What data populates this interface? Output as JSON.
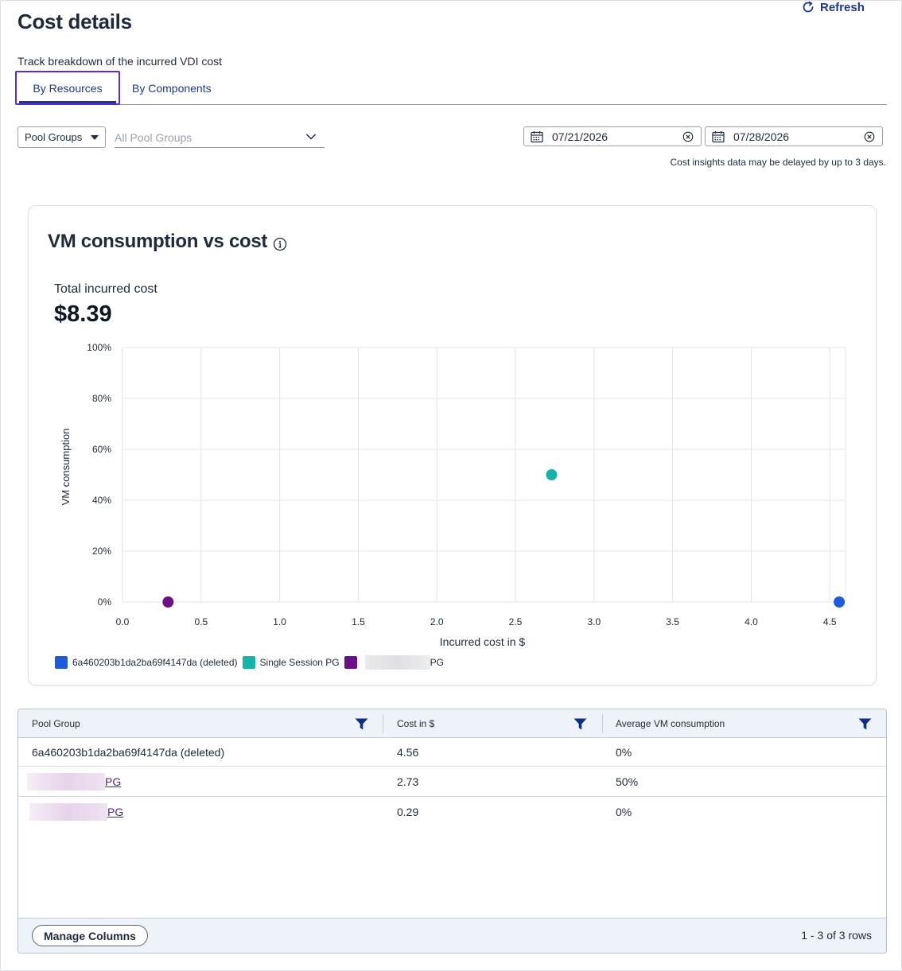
{
  "header": {
    "title": "Cost details",
    "refresh_label": "Refresh",
    "subtitle": "Track breakdown of the incurred VDI cost"
  },
  "tabs": [
    {
      "label": "By Resources",
      "active": true
    },
    {
      "label": "By Components",
      "active": false
    }
  ],
  "filters": {
    "group_by": "Pool Groups",
    "pool_placeholder": "All Pool Groups",
    "start_date": "07/21/2026",
    "end_date": "07/28/2026",
    "delay_note": "Cost insights data may be delayed by up to 3 days."
  },
  "chart_card": {
    "title": "VM consumption vs cost",
    "total_label": "Total incurred cost",
    "total_value": "$8.39"
  },
  "chart_data": {
    "type": "scatter",
    "xlabel": "Incurred cost in $",
    "ylabel": "VM consumption",
    "xlim": [
      0,
      4.6
    ],
    "ylim": [
      0,
      100
    ],
    "x_ticks": [
      "0.0",
      "0.5",
      "1.0",
      "1.5",
      "2.0",
      "2.5",
      "3.0",
      "3.5",
      "4.0",
      "4.5"
    ],
    "y_ticks": [
      "0%",
      "20%",
      "40%",
      "60%",
      "80%",
      "100%"
    ],
    "grid": true,
    "legend_position": "bottom-left",
    "series": [
      {
        "name": "6a460203b1da2ba69f4147da (deleted)",
        "color": "#1f5bd8",
        "x": 4.56,
        "y": 0
      },
      {
        "name": "Single Session PG",
        "color": "#17b3a6",
        "x": 2.73,
        "y": 50
      },
      {
        "name": "PG",
        "color": "#6b0f86",
        "x": 0.29,
        "y": 0,
        "name_redacted": true
      }
    ]
  },
  "table": {
    "columns": [
      "Pool Group",
      "Cost in $",
      "Average VM consumption"
    ],
    "rows": [
      {
        "pool_group": "6a460203b1da2ba69f4147da (deleted)",
        "link": false,
        "redacted": false,
        "cost": "4.56",
        "avg": "0%"
      },
      {
        "pool_group": " PG",
        "link": true,
        "redacted": true,
        "cost": "2.73",
        "avg": "50%"
      },
      {
        "pool_group": "PG",
        "link": true,
        "redacted": true,
        "cost": "0.29",
        "avg": "0%"
      }
    ],
    "manage_columns_label": "Manage Columns",
    "rows_count": "1 - 3 of 3 rows"
  }
}
